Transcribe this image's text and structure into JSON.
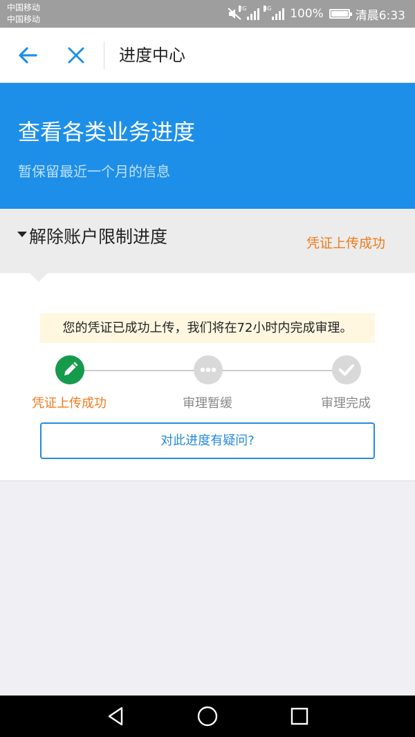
{
  "status_bar": {
    "carrier_1": "中国移动",
    "carrier_2": "中国移动",
    "network_1": "2G",
    "network_2": "4G",
    "battery": "100%",
    "time": "清晨6:33",
    "icons": [
      "mute-icon",
      "signal-icon",
      "battery-icon"
    ]
  },
  "nav": {
    "title": "进度中心",
    "back_icon": "back-arrow-icon",
    "close_icon": "close-icon",
    "accent_color": "#1d8fe8"
  },
  "banner": {
    "title": "查看各类业务进度",
    "subtitle": "暂保留最近一个月的信息",
    "bg_color": "#1d8fe8"
  },
  "section": {
    "title": "解除账户限制进度",
    "status": "凭证上传成功",
    "status_color": "#f07a1b"
  },
  "progress": {
    "notice": "您的凭证已成功上传，我们将在72小时内完成审理。",
    "steps": [
      {
        "label": "凭证上传成功",
        "icon": "pencil-icon",
        "state": "done"
      },
      {
        "label": "审理暂缓",
        "icon": "dots-icon",
        "state": "pending"
      },
      {
        "label": "审理完成",
        "icon": "check-icon",
        "state": "pending"
      }
    ],
    "question_button": "对此进度有疑问?"
  },
  "system_nav": {
    "icons": [
      "back-triangle-icon",
      "home-circle-icon",
      "recent-square-icon"
    ]
  }
}
